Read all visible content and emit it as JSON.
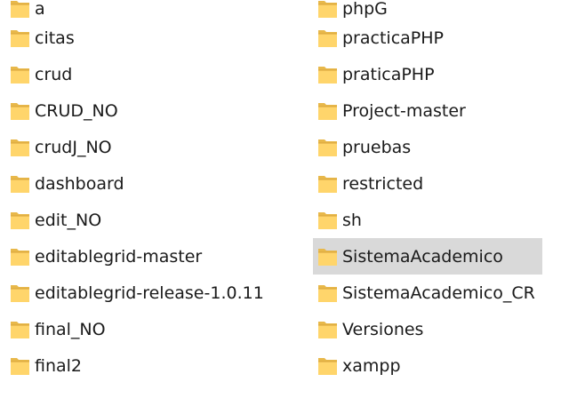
{
  "explorer": {
    "left_items": [
      {
        "label": "a"
      },
      {
        "label": "citas"
      },
      {
        "label": "crud"
      },
      {
        "label": "CRUD_NO"
      },
      {
        "label": "crudJ_NO"
      },
      {
        "label": "dashboard"
      },
      {
        "label": "edit_NO"
      },
      {
        "label": "editablegrid-master"
      },
      {
        "label": "editablegrid-release-1.0.11"
      },
      {
        "label": "final_NO"
      },
      {
        "label": "final2"
      }
    ],
    "right_items": [
      {
        "label": "phpG"
      },
      {
        "label": "practicaPHP"
      },
      {
        "label": "praticaPHP"
      },
      {
        "label": "Project-master"
      },
      {
        "label": "pruebas"
      },
      {
        "label": "restricted"
      },
      {
        "label": "sh"
      },
      {
        "label": "SistemaAcademico",
        "selected": true
      },
      {
        "label": "SistemaAcademico_CR"
      },
      {
        "label": "Versiones"
      },
      {
        "label": "xampp"
      }
    ],
    "icon": "folder-icon",
    "colors": {
      "folder_back": "#e8b84a",
      "folder_front": "#ffd56b",
      "selection": "#d9d9d9",
      "text": "#1a1a1a"
    }
  }
}
